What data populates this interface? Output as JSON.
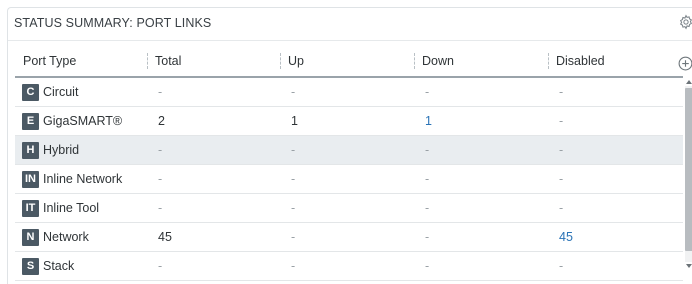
{
  "panel": {
    "title": "STATUS SUMMARY: PORT LINKS",
    "settings_icon": "gear-icon",
    "add_column_icon": "plus-circle-icon"
  },
  "table": {
    "columns": [
      "Port Type",
      "Total",
      "Up",
      "Down",
      "Disabled"
    ],
    "rows": [
      {
        "badge": "C",
        "name": "Circuit",
        "total": "-",
        "up": "-",
        "down": "-",
        "disabled": "-"
      },
      {
        "badge": "E",
        "name": "GigaSMART®",
        "total": "2",
        "up": "1",
        "down": "1",
        "disabled": "-"
      },
      {
        "badge": "H",
        "name": "Hybrid",
        "total": "-",
        "up": "-",
        "down": "-",
        "disabled": "-"
      },
      {
        "badge": "IN",
        "name": "Inline Network",
        "total": "-",
        "up": "-",
        "down": "-",
        "disabled": "-"
      },
      {
        "badge": "IT",
        "name": "Inline Tool",
        "total": "-",
        "up": "-",
        "down": "-",
        "disabled": "-"
      },
      {
        "badge": "N",
        "name": "Network",
        "total": "45",
        "up": "-",
        "down": "-",
        "disabled": "45"
      },
      {
        "badge": "S",
        "name": "Stack",
        "total": "-",
        "up": "-",
        "down": "-",
        "disabled": "-"
      }
    ],
    "selected_row_index": 2
  },
  "colors": {
    "badge_bg": "#4b5964",
    "link": "#2a73b6",
    "selected_row": "#e9edf0"
  }
}
